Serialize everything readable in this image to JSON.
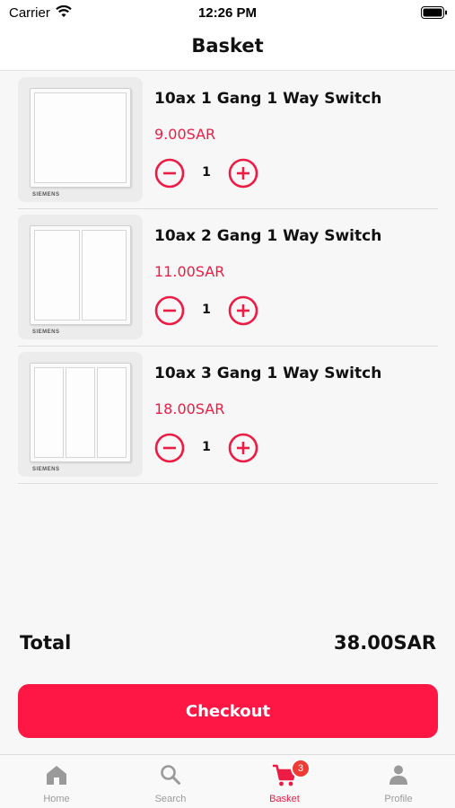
{
  "status_bar": {
    "carrier": "Carrier",
    "time": "12:26 PM",
    "icons": [
      "wifi-icon",
      "battery-icon"
    ]
  },
  "header": {
    "title": "Basket"
  },
  "basket": {
    "items": [
      {
        "name": "10ax 1 Gang 1 Way Switch",
        "price": "9.00SAR",
        "quantity": "1",
        "gangs": 1,
        "brand": "SIEMENS",
        "image_icon": "switch-1-gang-image"
      },
      {
        "name": "10ax 2 Gang 1 Way Switch",
        "price": "11.00SAR",
        "quantity": "1",
        "gangs": 2,
        "brand": "SIEMENS",
        "image_icon": "switch-2-gang-image"
      },
      {
        "name": "10ax 3 Gang 1 Way Switch",
        "price": "18.00SAR",
        "quantity": "1",
        "gangs": 3,
        "brand": "SIEMENS",
        "image_icon": "switch-3-gang-image"
      }
    ]
  },
  "summary": {
    "total_label": "Total",
    "total_value": "38.00SAR"
  },
  "checkout": {
    "label": "Checkout"
  },
  "tab_bar": {
    "tabs": [
      {
        "label": "Home",
        "icon": "home-icon",
        "active": false
      },
      {
        "label": "Search",
        "icon": "search-icon",
        "active": false
      },
      {
        "label": "Basket",
        "icon": "cart-icon",
        "active": true,
        "badge": "3"
      },
      {
        "label": "Profile",
        "icon": "profile-icon",
        "active": false
      }
    ]
  },
  "colors": {
    "accent": "#fe1744",
    "price": "#ec1c45",
    "badge": "#ee3b34",
    "inactive_tab": "#9a9a9a"
  }
}
